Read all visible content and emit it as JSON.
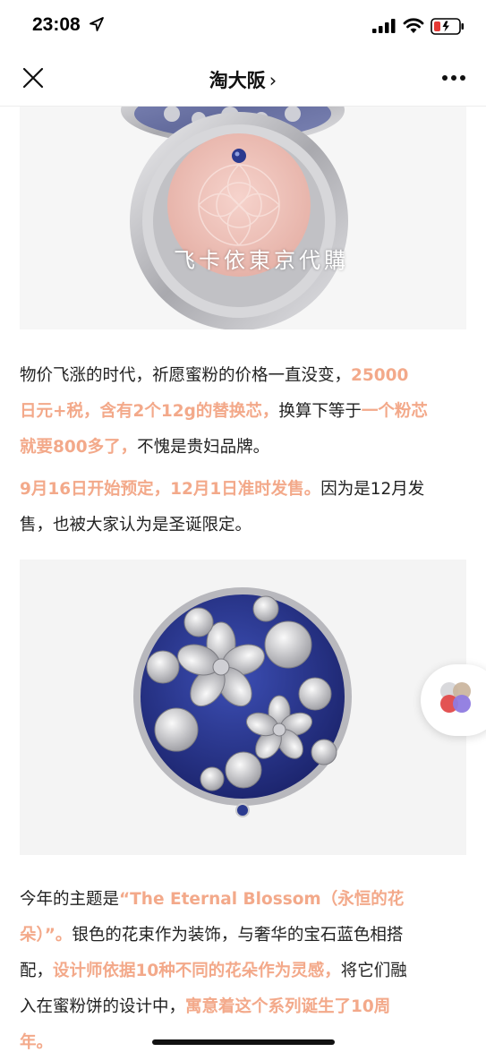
{
  "status_bar": {
    "time": "23:08",
    "icons": [
      "location-arrow-icon",
      "cellular-signal-icon",
      "wifi-icon",
      "battery-low-icon"
    ],
    "battery_color": "#e53935"
  },
  "nav": {
    "title": "淘大阪",
    "chevron": "›",
    "close_icon": "close-icon",
    "more_icon": "more-icon"
  },
  "article": {
    "image1": {
      "watermark": "飞卡依東京代購"
    },
    "para1": {
      "t1": "物价飞涨的时代，祈愿蜜粉的价格一直没变，",
      "h1": "25000",
      "h2": "日元+税，含有2个12g的替换芯，",
      "t2": "换算下等于",
      "h3": "一个粉芯",
      "h4": "就要800多了，",
      "t3": "不愧是贵妇品牌。"
    },
    "para2": {
      "h1": "9月16日开始预定，12月1日准时发售。",
      "t1": "因为是12月发",
      "t2": "售，也被大家认为是圣诞限定。"
    },
    "para3": {
      "t1": "今年的主题是",
      "h1": "“The Eternal Blossom（永恒的花",
      "h2": "朵）”。",
      "t2": "银色的花束作为装饰，与奢华的宝石蓝色相搭",
      "t3": "配，",
      "h3": "设计师依据10种不同的花朵作为灵感，",
      "t4": "将它们融",
      "t5": "入在蜜粉饼的设计中，",
      "h4": "寓意着这个系列诞生了10周",
      "h5": "年。"
    }
  },
  "colors": {
    "highlight": "#f3a98a",
    "text": "#222222",
    "compact_blue": "#2b3a8f",
    "silver": "#c9c9cc"
  }
}
